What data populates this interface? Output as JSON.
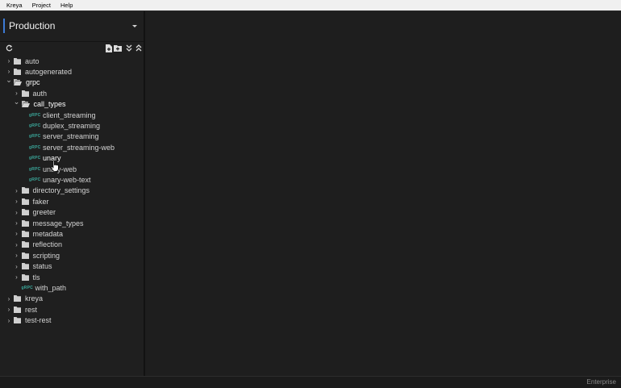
{
  "menu": [
    "Kreya",
    "Project",
    "Help"
  ],
  "environment": {
    "name": "Production"
  },
  "toolbar": {
    "refresh": "refresh-icon",
    "new_file": "new-file-icon",
    "new_folder": "new-folder-icon",
    "expand_all": "expand-all-icon",
    "collapse_all": "collapse-all-icon"
  },
  "tree": [
    {
      "label": "auto",
      "type": "folder",
      "depth": 0,
      "expanded": false
    },
    {
      "label": "autogenerated",
      "type": "folder",
      "depth": 0,
      "expanded": false
    },
    {
      "label": "grpc",
      "type": "folder",
      "depth": 0,
      "expanded": true
    },
    {
      "label": "auth",
      "type": "folder",
      "depth": 1,
      "expanded": false
    },
    {
      "label": "call_types",
      "type": "folder",
      "depth": 1,
      "expanded": true
    },
    {
      "label": "client_streaming",
      "type": "grpc",
      "depth": 2
    },
    {
      "label": "duplex_streaming",
      "type": "grpc",
      "depth": 2
    },
    {
      "label": "server_streaming",
      "type": "grpc",
      "depth": 2
    },
    {
      "label": "server_streaming-web",
      "type": "grpc",
      "depth": 2
    },
    {
      "label": "unary",
      "type": "grpc",
      "depth": 2,
      "hovered": true
    },
    {
      "label": "unary-web",
      "type": "grpc",
      "depth": 2
    },
    {
      "label": "unary-web-text",
      "type": "grpc",
      "depth": 2
    },
    {
      "label": "directory_settings",
      "type": "folder",
      "depth": 1,
      "expanded": false
    },
    {
      "label": "faker",
      "type": "folder",
      "depth": 1,
      "expanded": false
    },
    {
      "label": "greeter",
      "type": "folder",
      "depth": 1,
      "expanded": false
    },
    {
      "label": "message_types",
      "type": "folder",
      "depth": 1,
      "expanded": false
    },
    {
      "label": "metadata",
      "type": "folder",
      "depth": 1,
      "expanded": false
    },
    {
      "label": "reflection",
      "type": "folder",
      "depth": 1,
      "expanded": false
    },
    {
      "label": "scripting",
      "type": "folder",
      "depth": 1,
      "expanded": false
    },
    {
      "label": "status",
      "type": "folder",
      "depth": 1,
      "expanded": false
    },
    {
      "label": "tls",
      "type": "folder",
      "depth": 1,
      "expanded": false
    },
    {
      "label": "with_path",
      "type": "grpc",
      "depth": 1
    },
    {
      "label": "kreya",
      "type": "folder",
      "depth": 0,
      "expanded": false
    },
    {
      "label": "rest",
      "type": "folder",
      "depth": 0,
      "expanded": false
    },
    {
      "label": "test-rest",
      "type": "folder",
      "depth": 0,
      "expanded": false
    }
  ],
  "grpc_badge": "gRPC",
  "status": {
    "edition": "Enterprise"
  }
}
